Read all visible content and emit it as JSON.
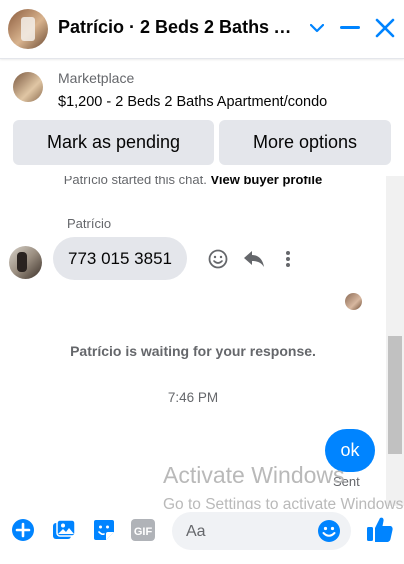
{
  "header": {
    "title": "Patrício · 2 Beds 2 Baths A…",
    "accent": "#0084ff"
  },
  "listing": {
    "marketplace_label": "Marketplace",
    "title": "$1,200 - 2 Beds 2 Baths Apartment/condo",
    "mark_pending_label": "Mark as pending",
    "more_options_label": "More options"
  },
  "chat": {
    "started_text": "Patrício started this chat.",
    "view_profile_label": "View buyer profile",
    "sender_name": "Patrício",
    "incoming_message": "773 015 3851",
    "waiting_text": "Patrício is waiting for your response.",
    "timestamp": "7:46 PM",
    "outgoing_message": "ok",
    "sent_status": "Sent"
  },
  "watermark": {
    "title": "Activate Windows",
    "subtitle": "Go to Settings to activate Windows."
  },
  "composer": {
    "placeholder": "Aa",
    "gif_label": "GIF",
    "icons": [
      "plus-icon",
      "photo-icon",
      "sticker-icon",
      "gif-icon",
      "emoji-icon",
      "like-icon"
    ]
  }
}
